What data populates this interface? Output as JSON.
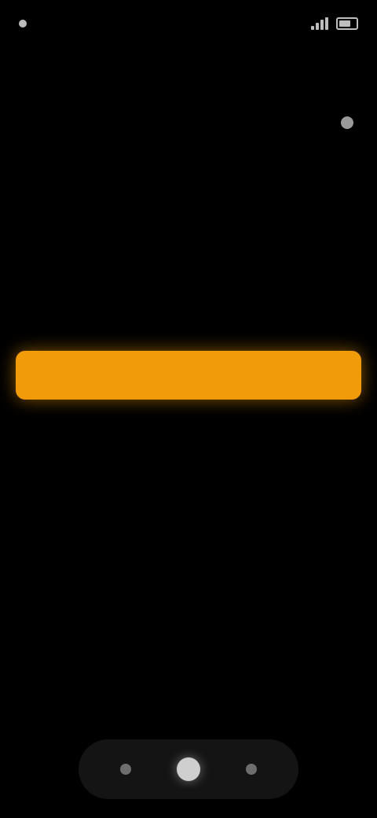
{
  "status_bar": {
    "time": "",
    "icons": [
      "dot-icon",
      "signal-icon",
      "battery-icon"
    ]
  },
  "header": {
    "page_title": "",
    "video_title": ""
  },
  "tabs": [
    {
      "label": ""
    },
    {
      "label": ""
    },
    {
      "label": ""
    },
    {
      "label": ""
    }
  ],
  "description": {
    "text": ""
  },
  "primary_button": {
    "label": "",
    "color": "#f29b0a"
  },
  "bottom_nav": {
    "items": [
      {
        "icon": "home-icon",
        "active": false
      },
      {
        "icon": "play-icon",
        "active": true
      },
      {
        "icon": "profile-icon",
        "active": false
      }
    ]
  },
  "colors": {
    "background": "#000000",
    "accent": "#f29b0a"
  }
}
